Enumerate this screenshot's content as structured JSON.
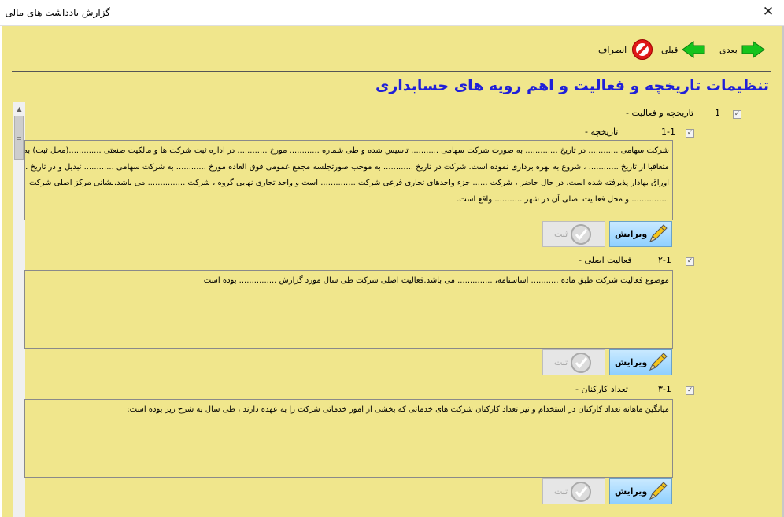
{
  "window": {
    "title": "گزارش یادداشت های مالی",
    "close_glyph": "✕"
  },
  "toolbar": {
    "next_label": "بعدی",
    "prev_label": "قبلی",
    "cancel_label": "انصراف"
  },
  "header": {
    "title": "تنظیمات تاریخچه و فعالیت و اهم رویه های حسابداری"
  },
  "section": {
    "number": "1",
    "title": "- تاریخچه و فعالیت"
  },
  "items": [
    {
      "number": "1-1",
      "title": "- تاریخچه",
      "lines": [
        "شرکت سهامی ............ در تاریخ ............. به صورت شرکت سهامی ........... تاسیس شده و طی شماره ............ مورخ ............ در اداره ثبت شرکت ها و مالکیت صنعتی .............(محل ثبت) به ثبت رسید",
        "متعاقبا از تاریخ ............ ، شروع به بهره برداری نموده است. شرکت در تاریخ ............ به موجب صورتجلسه مجمع عمومی فوق العاده مورخ ............ به شرکت سهامی ............ تبدیل و در تاریخ ......... در بورس",
        "اوراق بهادار پذیرفته شده است. در حال حاضر ، شرکت ...... جزء واحدهای تجاری فرعی شرکت .............. است و واحد تجاری نهایی گروه ، شرکت ............... می باشد.نشانی مرکز اصلی شرکت",
        "............... و محل فعالیت اصلی آن در شهر ........... واقع است."
      ]
    },
    {
      "number": "۲-1",
      "title": "- فعالیت اصلی",
      "lines": [
        "موضوع فعالیت شرکت طبق ماده ........... اساسنامه، .............. می باشد.فعالیت اصلی شرکت طی سال مورد گزارش ............... بوده است"
      ]
    },
    {
      "number": "۳-1",
      "title": "- تعداد کارکنان",
      "lines": [
        "میانگین ماهانه تعداد کارکنان در استخدام و نیز تعداد کارکنان شرکت های خدماتی که بخشی از امور خدماتی شرکت را به عهده دارند ، طی سال به شرح زیر بوده است:"
      ]
    }
  ],
  "buttons": {
    "edit_label": "ویرایش",
    "save_label": "ثبت"
  },
  "checkbox_glyph": "✓",
  "colors": {
    "background": "#f0e68c",
    "title_blue": "#2020d8",
    "arrow_green": "#16c41d",
    "cancel_red": "#e01818"
  },
  "icons": [
    "arrow-right-green-icon",
    "arrow-left-green-icon",
    "no-entry-icon",
    "pencil-icon",
    "check-circle-icon"
  ]
}
